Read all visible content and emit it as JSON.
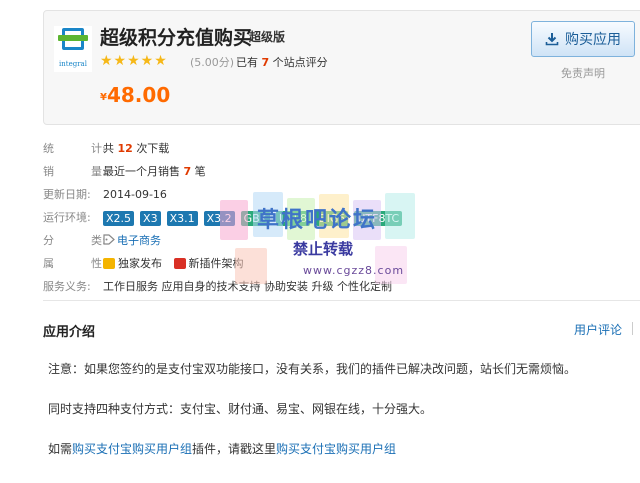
{
  "product": {
    "title": "超级积分充值购买",
    "edition": "超级版",
    "logo_word": "integral",
    "stars": "★★★★★",
    "score": "(5.00分)",
    "rating_prefix": "已有",
    "rating_count": "7",
    "rating_suffix": "个站点评分",
    "price_currency": "¥",
    "price": "48.00",
    "buy_button": "购买应用",
    "disclaimer": "免责声明"
  },
  "info": {
    "downloads": {
      "label1": "统",
      "label2": "计:",
      "prefix": "共",
      "count": "12",
      "suffix": "次下载"
    },
    "sales": {
      "label1": "销",
      "label2": "量:",
      "prefix": "最近一个月销售",
      "count": "7",
      "suffix": "笔"
    },
    "updated": {
      "label": "更新日期:",
      "value": "2014-09-16"
    },
    "env": {
      "label": "运行环境:",
      "tags": [
        "X2.5",
        "X3",
        "X3.1",
        "X3.2",
        "GBK",
        "UTF8",
        "BIG5",
        "UTF8TC"
      ]
    },
    "category": {
      "label1": "分",
      "label2": "类:",
      "value": "电子商务"
    },
    "attributes": {
      "label1": "属",
      "label2": "性:",
      "exclusive": "独家发布",
      "new_arch": "新插件架构"
    },
    "service": {
      "label": "服务义务:",
      "value": "工作日服务  应用自身的技术支持  协助安装  升级  个性化定制"
    }
  },
  "watermark": {
    "line1": "草根吧论坛",
    "line2": "禁止转载",
    "line3": "www.cgzz8.com"
  },
  "intro": {
    "title": "应用介绍",
    "review_link": "用户评论",
    "p1": "注意：如果您签约的是支付宝双功能接口，没有关系，我们的插件已解决改问题，站长们无需烦恼。",
    "p2": "同时支持四种支付方式：支付宝、财付通、易宝、网银在线，十分强大。",
    "p3_prefix": "如需",
    "p3_link1": "购买支付宝购买用户组",
    "p3_middle": "插件，请戳这里",
    "p3_link2": "购买支付宝购买用户组"
  },
  "colors": {
    "price": "#ff6a00",
    "link": "#1a6fb5",
    "highlight": "#e03a00",
    "tag": "#1d78b0"
  }
}
